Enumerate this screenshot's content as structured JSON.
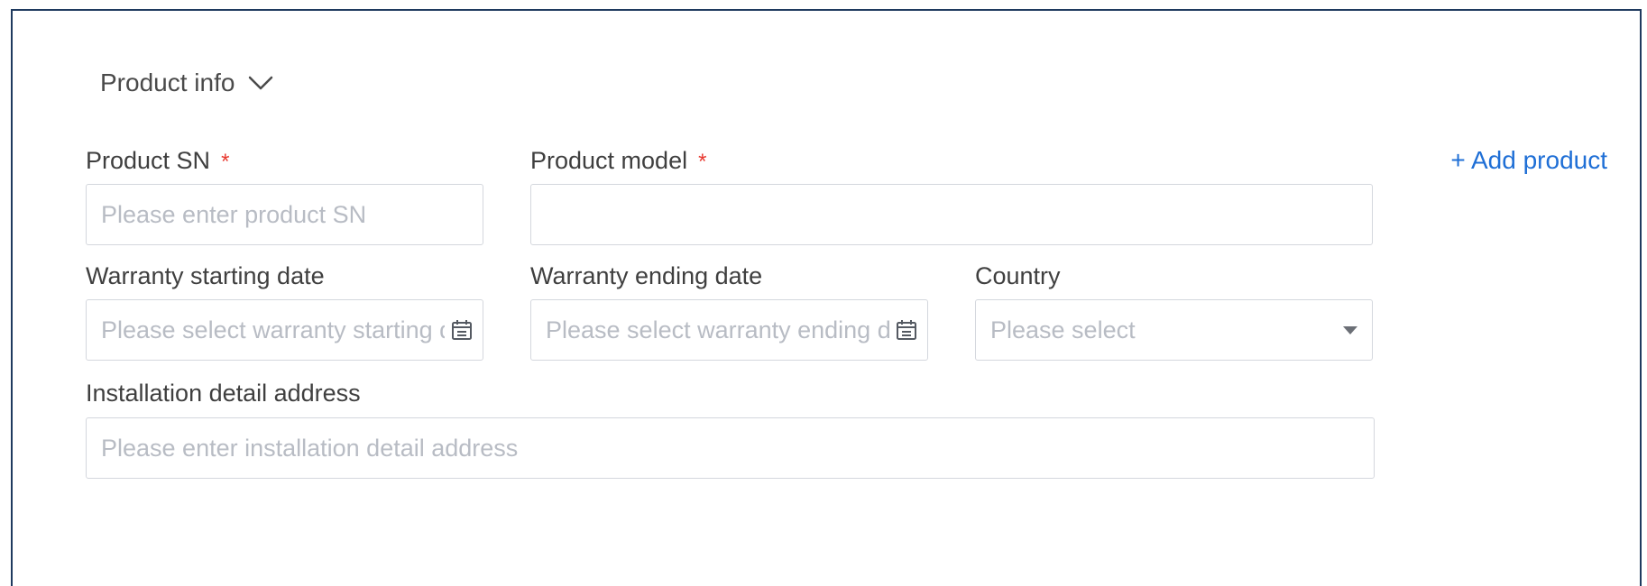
{
  "section": {
    "title": "Product info",
    "toggle_icon": "chevron-down-icon"
  },
  "fields": {
    "product_sn": {
      "label": "Product SN",
      "required_mark": "*",
      "placeholder": "Please enter product SN",
      "value": ""
    },
    "product_model": {
      "label": "Product model",
      "required_mark": "*",
      "value": ""
    },
    "add_product": {
      "label": "+ Add product"
    },
    "warranty_start": {
      "label": "Warranty starting date",
      "placeholder": "Please select warranty starting date",
      "icon": "calendar-icon"
    },
    "warranty_end": {
      "label": "Warranty ending date",
      "placeholder": "Please select warranty ending date",
      "icon": "calendar-icon"
    },
    "country": {
      "label": "Country",
      "placeholder": "Please select",
      "icon": "caret-down-icon"
    },
    "address": {
      "label": "Installation detail address",
      "placeholder": "Please enter installation detail address",
      "value": ""
    }
  },
  "colors": {
    "frame_border": "#1f3a5f",
    "required": "#e8382f",
    "link": "#1f6fd6",
    "input_border": "#d4d7dd",
    "placeholder": "#b8bcc4"
  }
}
